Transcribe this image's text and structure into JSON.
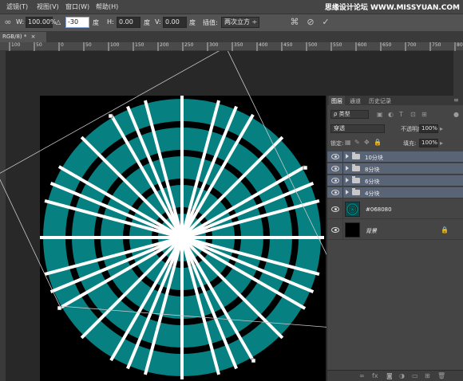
{
  "menubar": {
    "items": [
      "滤镜(T)",
      "视图(V)",
      "窗口(W)",
      "帮助(H)"
    ],
    "watermark": "思缘设计论坛 WWW.MISSYUAN.COM"
  },
  "options": {
    "w_label": "W:",
    "w_value": "100.00%",
    "angle_label": "△",
    "angle_value": "-30",
    "deg1": "度",
    "h_label": "H:",
    "h_value": "0.00",
    "deg2": "度",
    "v_label": "V:",
    "v_value": "0.00",
    "deg3": "度",
    "interp_label": "插值:",
    "interp_value": "两次立方 ÷"
  },
  "document": {
    "tab_label": "RGB/8) *",
    "ruler_ticks": [
      "100",
      "50",
      "0",
      "50",
      "100",
      "150",
      "200",
      "250",
      "300",
      "350",
      "400",
      "450",
      "500",
      "550",
      "600",
      "650",
      "700",
      "750",
      "800"
    ]
  },
  "artwork": {
    "background_color": "#000000",
    "disc_color": "#068080",
    "ring_color": "#000000",
    "spoke_color": "#ffffff",
    "rings": 4,
    "spoke_count": 12
  },
  "layers_panel": {
    "tabs": [
      "图层",
      "通道",
      "历史记录"
    ],
    "kind_filter": "ρ 类型",
    "blend_mode": "穿透",
    "opacity_label": "不透明度:",
    "opacity_value": "100%",
    "lock_label": "锁定:",
    "fill_label": "填充:",
    "fill_value": "100%",
    "groups": [
      "10分块",
      "8分块",
      "6分块",
      "4分块"
    ],
    "layers": [
      {
        "name": "#068080",
        "thumb_color": "#068080"
      },
      {
        "name": "背景",
        "thumb_color": "#000000"
      }
    ],
    "footer_icons": [
      "link-icon",
      "fx-icon",
      "mask-icon",
      "adjustment-icon",
      "folder-icon",
      "new-layer-icon",
      "trash-icon"
    ]
  }
}
